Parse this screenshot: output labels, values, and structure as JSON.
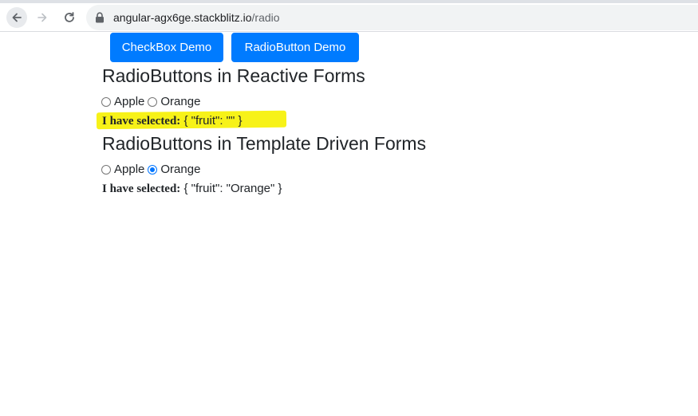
{
  "browser": {
    "url_host": "angular-agx6ge.stackblitz.io",
    "url_path": "/radio"
  },
  "nav": {
    "checkbox_button": "CheckBox Demo",
    "radio_button": "RadioButton Demo"
  },
  "reactive": {
    "heading": "RadioButtons in Reactive Forms",
    "options": [
      "Apple",
      "Orange"
    ],
    "selected_option": "",
    "selected_label": "I have selected:",
    "selected_value": "{ \"fruit\": \"\" }"
  },
  "template": {
    "heading": "RadioButtons in Template Driven Forms",
    "options": [
      "Apple",
      "Orange"
    ],
    "selected_option": "Orange",
    "selected_label": "I have selected:",
    "selected_value": "{ \"fruit\": \"Orange\" }"
  },
  "colors": {
    "primary": "#007bff",
    "highlight": "#f7f218",
    "radio_checked": "#0075ff"
  },
  "icons": [
    "back-arrow-icon",
    "forward-arrow-icon",
    "reload-icon",
    "lock-icon"
  ]
}
